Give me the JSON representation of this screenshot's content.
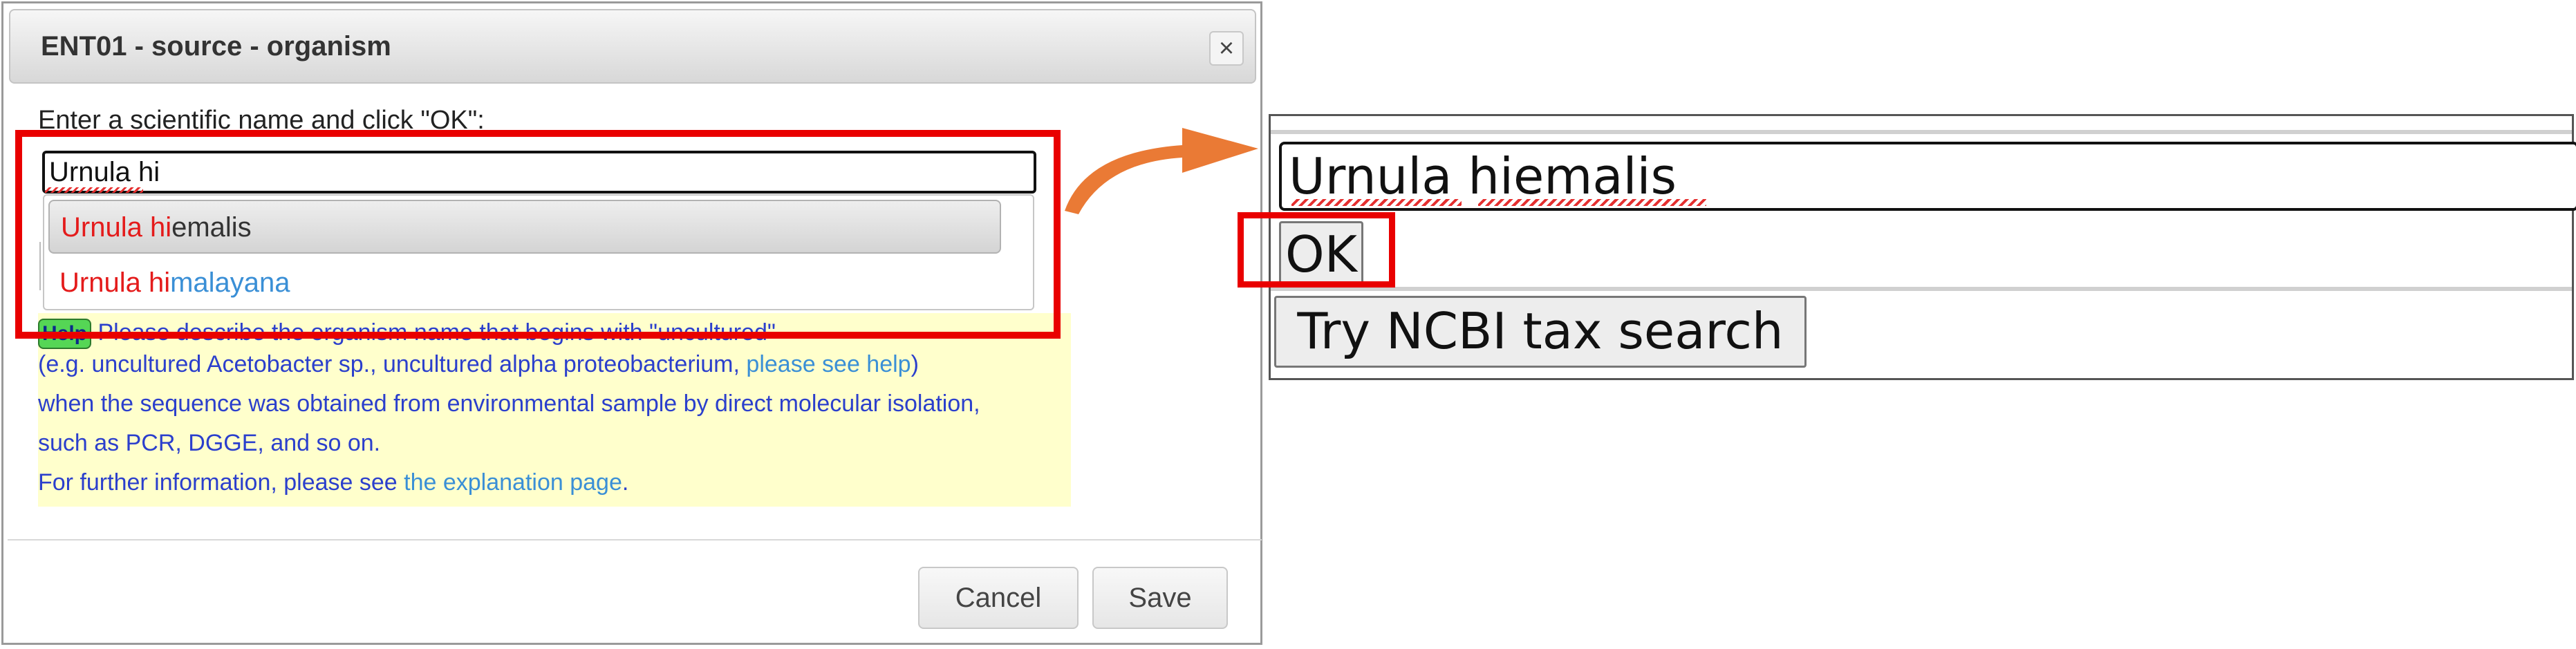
{
  "dialog": {
    "title": "ENT01 - source - organism",
    "close_glyph": "×",
    "prompt": "Enter a scientific name and click \"OK\":",
    "input_value": "Urnula hi",
    "suggestions": [
      {
        "match": "Urnula hi",
        "rest": "emalis"
      },
      {
        "match": "Urnula hi",
        "rest": "malayana"
      }
    ],
    "help": {
      "badge": "Help",
      "line1": "Please describe the organism name that begins with \"uncultured\"",
      "line2_pre": "(e.g. uncultured Acetobacter sp., uncultured alpha proteobacterium, ",
      "line2_link": "please see help",
      "line2_post": ")",
      "line3": "when the sequence was obtained from environmental sample by direct molecular isolation,",
      "line4": "such as PCR, DGGE, and so on.",
      "line5_pre": "For further information, please see ",
      "line5_link": "the explanation page",
      "line5_post": "."
    },
    "cancel_label": "Cancel",
    "save_label": "Save"
  },
  "zoom": {
    "input_value": "Urnula hiemalis",
    "ok_label": "OK",
    "ncbi_label": "Try NCBI tax search"
  },
  "colors": {
    "highlight_frame": "#e90000",
    "arrow": "#ea7a35",
    "match_text": "#e41b1b",
    "link": "#3a8fd6",
    "help_bg": "#ffffcc"
  }
}
